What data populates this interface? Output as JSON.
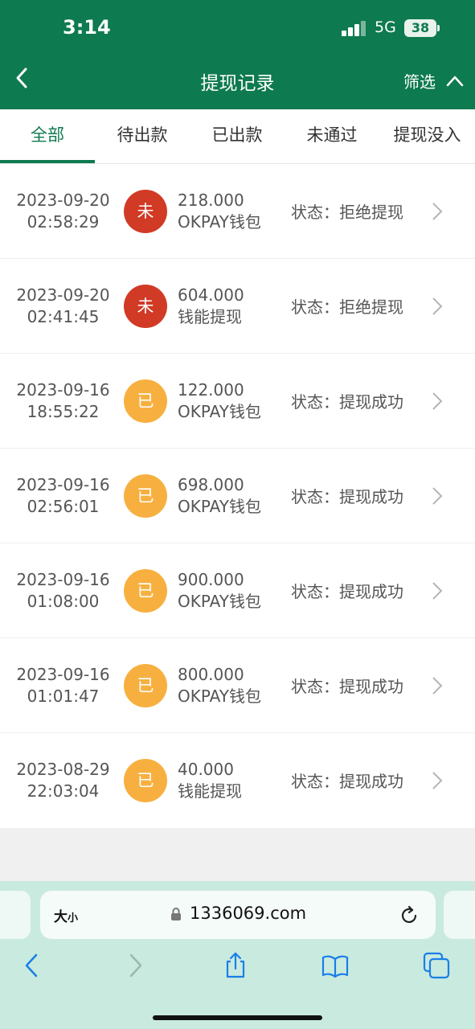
{
  "status_bar": {
    "time": "3:14",
    "network": "5G",
    "battery": "38"
  },
  "header": {
    "title": "提现记录",
    "filter": "筛选"
  },
  "tabs": [
    {
      "label": "全部",
      "active": true
    },
    {
      "label": "待出款",
      "active": false
    },
    {
      "label": "已出款",
      "active": false
    },
    {
      "label": "未通过",
      "active": false
    },
    {
      "label": "提现没入",
      "active": false
    }
  ],
  "records": [
    {
      "date": "2023-09-20",
      "time": "02:58:29",
      "badge": "未",
      "badge_color": "#d13a25",
      "amount": "218.000",
      "method": "OKPAY钱包",
      "status": "状态：拒绝提现"
    },
    {
      "date": "2023-09-20",
      "time": "02:41:45",
      "badge": "未",
      "badge_color": "#d13a25",
      "amount": "604.000",
      "method": "钱能提现",
      "status": "状态：拒绝提现"
    },
    {
      "date": "2023-09-16",
      "time": "18:55:22",
      "badge": "已",
      "badge_color": "#f7b040",
      "amount": "122.000",
      "method": "OKPAY钱包",
      "status": "状态：提现成功"
    },
    {
      "date": "2023-09-16",
      "time": "02:56:01",
      "badge": "已",
      "badge_color": "#f7b040",
      "amount": "698.000",
      "method": "OKPAY钱包",
      "status": "状态：提现成功"
    },
    {
      "date": "2023-09-16",
      "time": "01:08:00",
      "badge": "已",
      "badge_color": "#f7b040",
      "amount": "900.000",
      "method": "OKPAY钱包",
      "status": "状态：提现成功"
    },
    {
      "date": "2023-09-16",
      "time": "01:01:47",
      "badge": "已",
      "badge_color": "#f7b040",
      "amount": "800.000",
      "method": "OKPAY钱包",
      "status": "状态：提现成功"
    },
    {
      "date": "2023-08-29",
      "time": "22:03:04",
      "badge": "已",
      "badge_color": "#f7b040",
      "amount": "40.000",
      "method": "钱能提现",
      "status": "状态：提现成功"
    }
  ],
  "browser": {
    "text_size": "大",
    "text_size_small": "小",
    "url": "1336069.com"
  },
  "colors": {
    "brand": "#0e7a4f",
    "rejected": "#d13a25",
    "success": "#f7b040"
  }
}
